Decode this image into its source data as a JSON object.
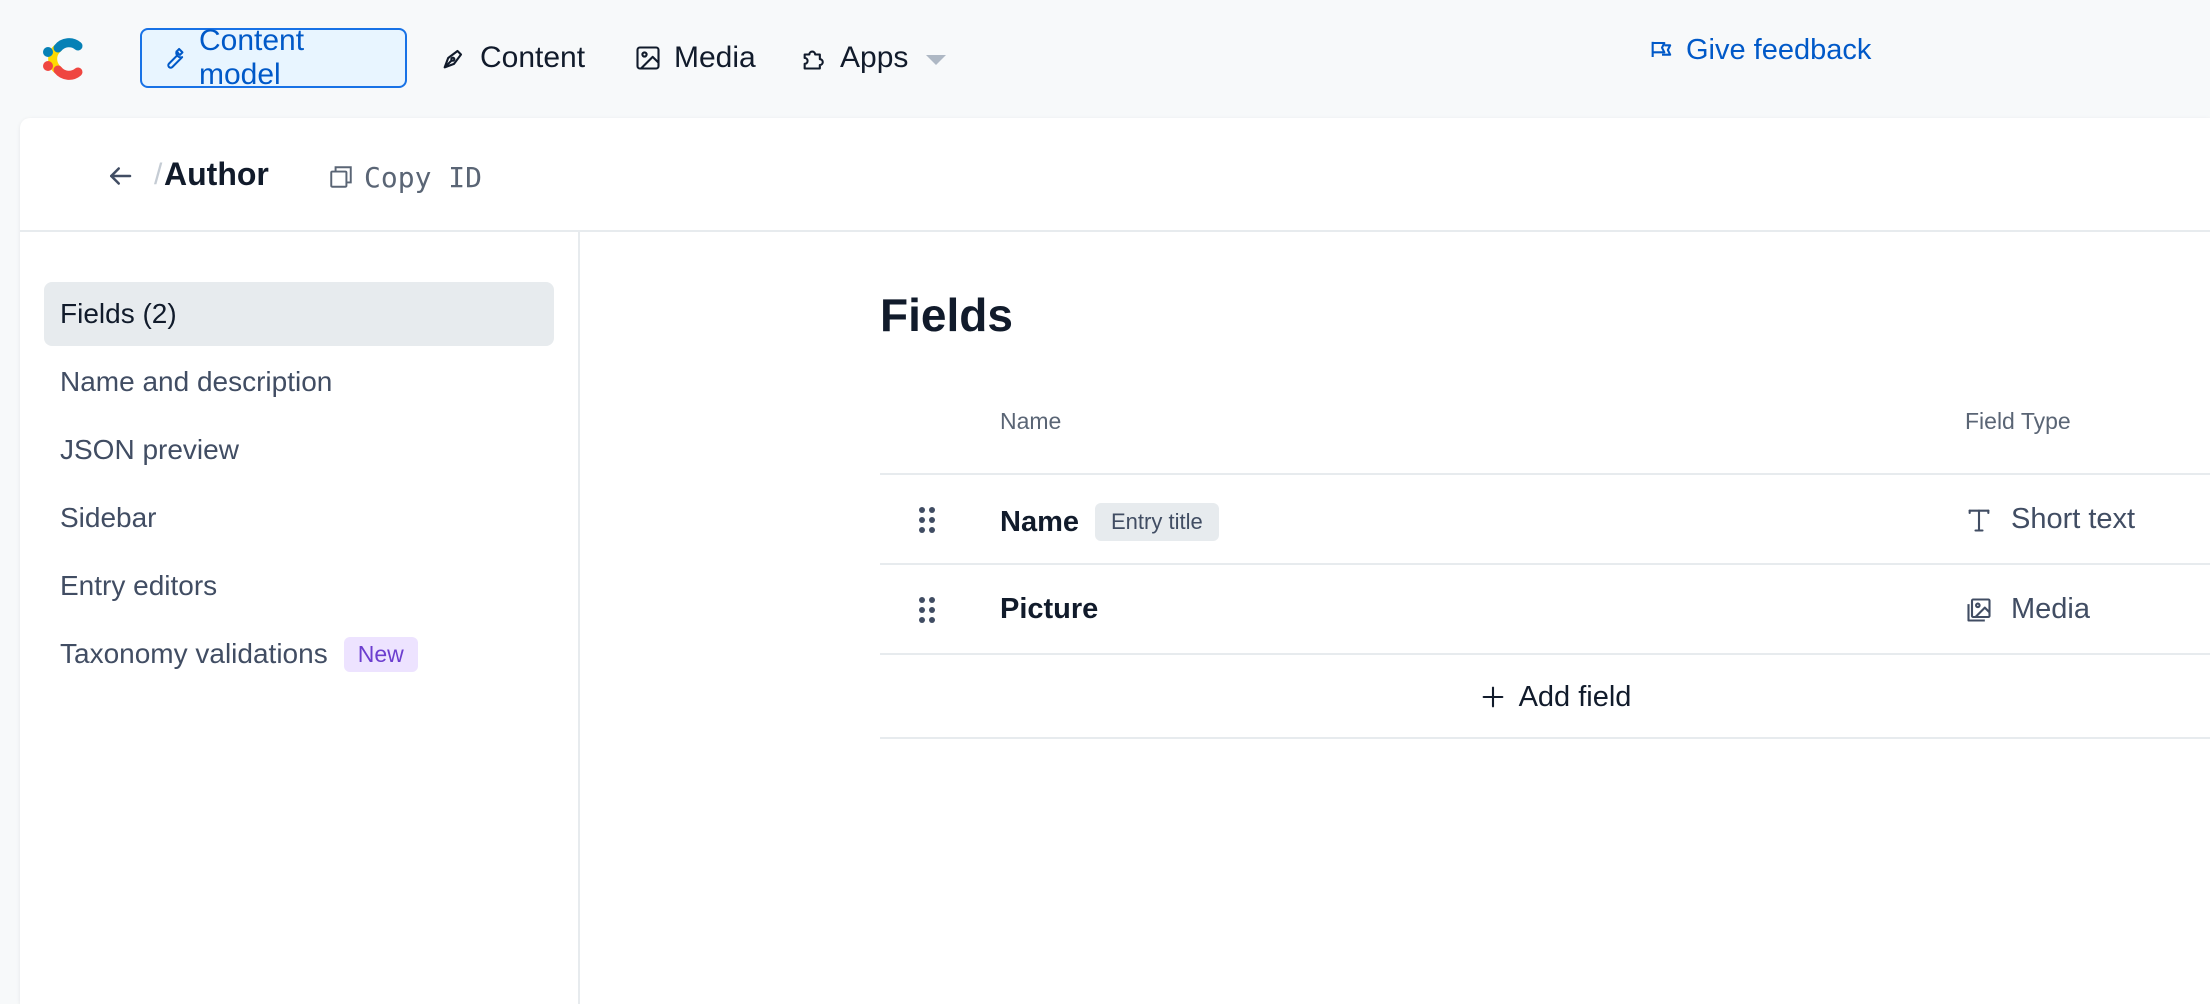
{
  "nav": {
    "items": [
      {
        "label": "Content model",
        "icon": "wrench-icon"
      },
      {
        "label": "Content",
        "icon": "pen-nib-icon"
      },
      {
        "label": "Media",
        "icon": "image-icon"
      },
      {
        "label": "Apps",
        "icon": "puzzle-icon"
      }
    ],
    "feedback_label": "Give feedback"
  },
  "header": {
    "title": "Author",
    "copy_id_label": "Copy ID"
  },
  "sidebar": {
    "items": [
      {
        "label": "Fields (2)",
        "active": true
      },
      {
        "label": "Name and description"
      },
      {
        "label": "JSON preview"
      },
      {
        "label": "Sidebar"
      },
      {
        "label": "Entry editors"
      },
      {
        "label": "Taxonomy validations",
        "badge": "New"
      }
    ]
  },
  "fields": {
    "title": "Fields",
    "columns": {
      "name": "Name",
      "type": "Field Type"
    },
    "rows": [
      {
        "name": "Name",
        "badge": "Entry title",
        "type": "Short text",
        "type_icon": "text-t-icon"
      },
      {
        "name": "Picture",
        "type": "Media",
        "type_icon": "image-icon"
      }
    ],
    "add_label": "Add field"
  },
  "colors": {
    "accent": "#0059c8",
    "accent_border": "#1872e6",
    "accent_bg": "#e8f5ff",
    "new_badge_bg": "#ede3ff",
    "new_badge_text": "#6c3ecf"
  }
}
